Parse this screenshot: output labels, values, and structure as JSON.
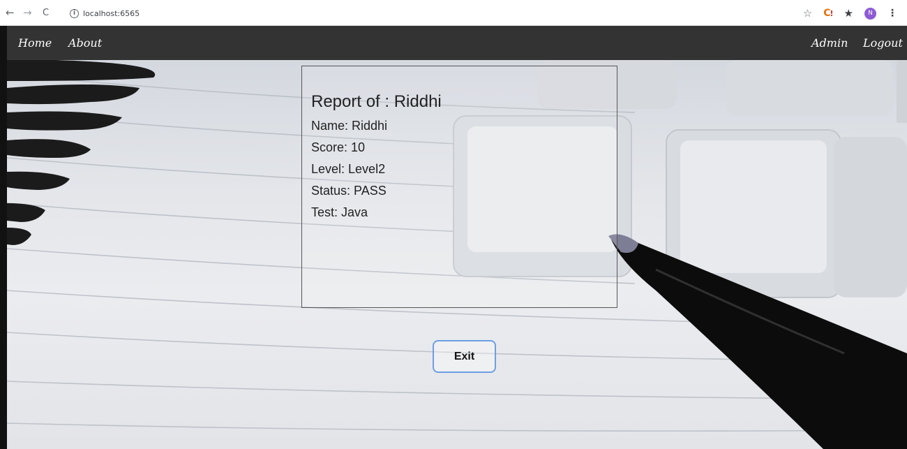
{
  "browser": {
    "back": "←",
    "forward": "→",
    "reload": "C",
    "url": "localhost:6565",
    "info_glyph": "i",
    "star_glyph": "☆",
    "extension_glyph": "C",
    "extension_badge": "!",
    "puzzle_glyph": "★",
    "profile_initial": "N",
    "menu_glyph": "⋮"
  },
  "navbar": {
    "home": "Home",
    "about": "About",
    "admin": "Admin",
    "logout": "Logout"
  },
  "report": {
    "title": "Report of : Riddhi",
    "name": "Name: Riddhi",
    "score": "Score: 10",
    "level": "Level: Level2",
    "status": "Status: PASS",
    "test": "Test: Java"
  },
  "exit_label": "Exit",
  "colors": {
    "navbar_bg": "#333333",
    "button_border": "#6c9fe2",
    "avatar": "#8e5bd6"
  }
}
